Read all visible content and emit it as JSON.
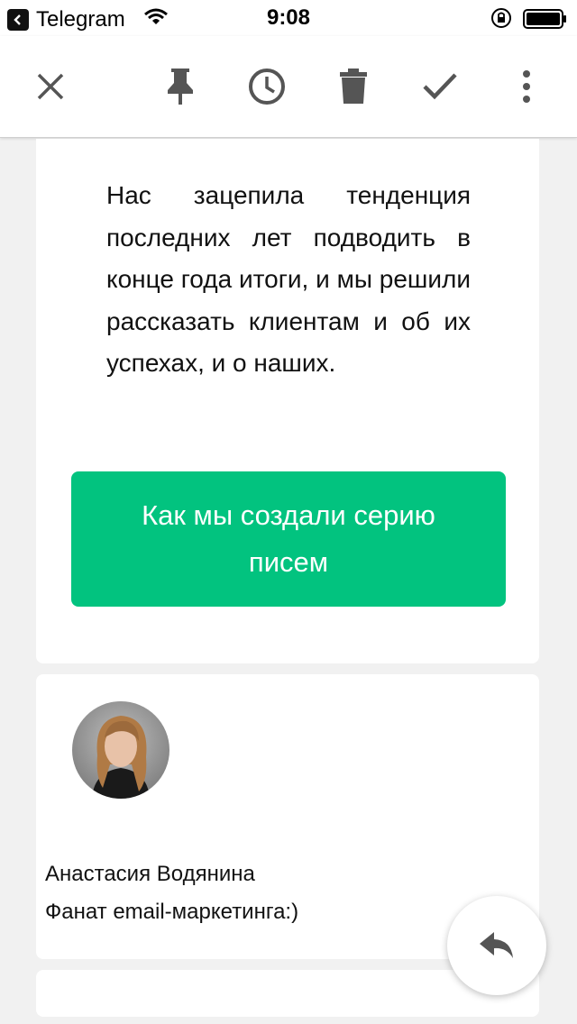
{
  "status_bar": {
    "back_app": "Telegram",
    "time": "9:08"
  },
  "toolbar": {
    "icons": [
      "close-icon",
      "pin-icon",
      "snooze-icon",
      "delete-icon",
      "done-icon",
      "more-icon"
    ]
  },
  "email": {
    "body_text": "Нас зацепила тенденция последних лет подводить в конце года итоги, и мы решили рассказать клиентам и об их успехах, и о наших.",
    "cta_label": "Как мы создали серию писем",
    "cta_color": "#02c37f",
    "signature": {
      "name": "Анастасия Водянина",
      "role": "Фанат email-маркетинга:)"
    }
  },
  "fab": {
    "icon": "reply-icon"
  }
}
